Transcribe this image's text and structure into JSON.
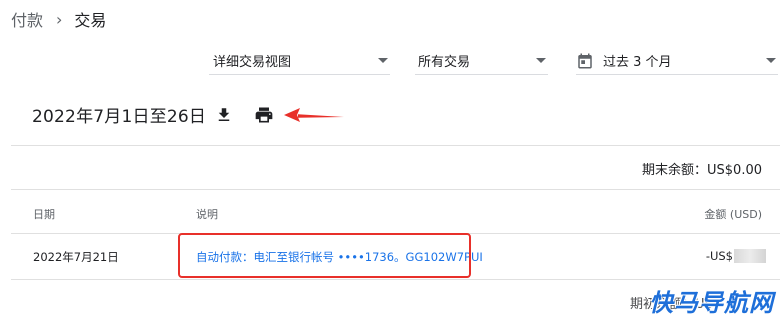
{
  "breadcrumb": {
    "parent": "付款",
    "separator": "›",
    "current": "交易"
  },
  "filters": {
    "view": "详细交易视图",
    "type": "所有交易",
    "range": "过去 3 个月",
    "range_icon": "calendar-icon"
  },
  "title": {
    "date_range": "2022年7月1日至26日",
    "download_icon": "download-icon",
    "print_icon": "print-icon",
    "annotation_arrow_color": "#e8302a"
  },
  "balance": {
    "ending": "期末余额：US$0.00"
  },
  "table": {
    "headers": {
      "date": "日期",
      "description": "说明",
      "amount": "金额 (USD)"
    },
    "rows": [
      {
        "date": "2022年7月21日",
        "description": "自动付款：电汇至银行帐号 ••••1736。GG102W7PUI",
        "amount_prefix": "-US$",
        "amount_redacted": true
      }
    ]
  },
  "footer": {
    "partial_text": "期初余额：US"
  },
  "watermark": {
    "text": "快马导航网",
    "color": "#1e6fd9"
  },
  "colors": {
    "link": "#1a73e8",
    "highlight": "#e8302a",
    "text": "#202124",
    "muted": "#5f6368"
  }
}
